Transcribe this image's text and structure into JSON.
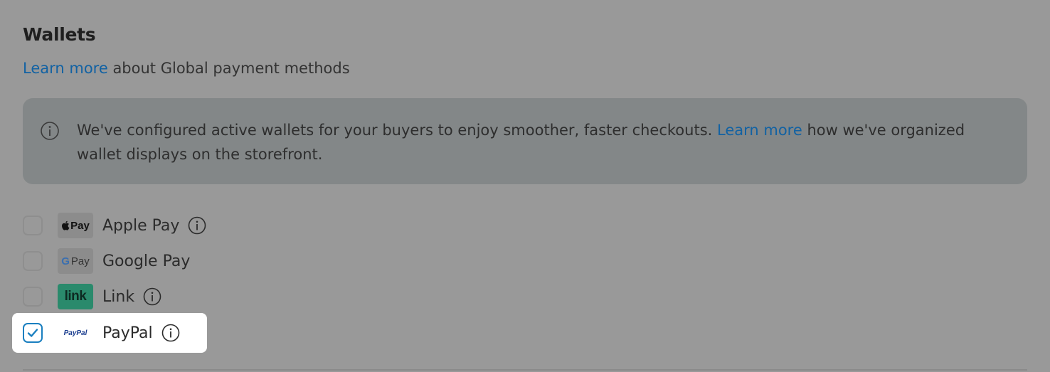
{
  "section": {
    "title": "Wallets",
    "learn_more_link": "Learn more",
    "subtitle_rest": " about Global payment methods"
  },
  "banner": {
    "text_before": "We've configured active wallets for your buyers to enjoy smoother, faster checkouts. ",
    "link": "Learn more",
    "text_after": " how we've organized wallet displays on the storefront.",
    "icon": "info-icon"
  },
  "wallets": [
    {
      "name": "Apple Pay",
      "logo_text": "Pay",
      "checked": false,
      "has_info": true,
      "logo_icon": "apple-pay-logo"
    },
    {
      "name": "Google Pay",
      "logo_text": "Pay",
      "checked": false,
      "has_info": false,
      "logo_icon": "google-pay-logo"
    },
    {
      "name": "Link",
      "logo_text": "link",
      "checked": false,
      "has_info": true,
      "logo_icon": "link-logo"
    },
    {
      "name": "PayPal",
      "logo_text": "PayPal",
      "checked": true,
      "has_info": true,
      "logo_icon": "paypal-logo"
    }
  ],
  "colors": {
    "overlay": "#999999",
    "link": "#1262a3",
    "checkbox_checked": "#1a7fc0",
    "link_logo_bg": "#2a8a6c"
  }
}
